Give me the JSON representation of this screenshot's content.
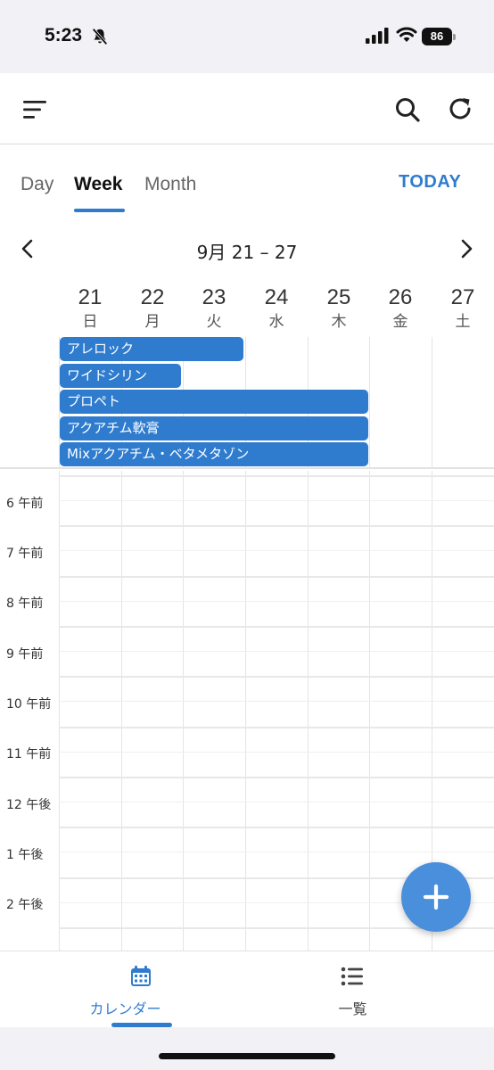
{
  "status_bar": {
    "time": "5:23",
    "battery": "86"
  },
  "app_bar": {
    "icons": [
      "menu-icon",
      "search-icon",
      "refresh-icon"
    ]
  },
  "view_tabs": {
    "tabs": [
      "Day",
      "Week",
      "Month"
    ],
    "active": "Week",
    "today_label": "TODAY"
  },
  "week_nav": {
    "range_label": "9月 21 – 27"
  },
  "days": [
    {
      "num": "21",
      "name": "日"
    },
    {
      "num": "22",
      "name": "月"
    },
    {
      "num": "23",
      "name": "火"
    },
    {
      "num": "24",
      "name": "水"
    },
    {
      "num": "25",
      "name": "木"
    },
    {
      "num": "26",
      "name": "金"
    },
    {
      "num": "27",
      "name": "土"
    }
  ],
  "all_day_events": [
    {
      "title": "アレロック",
      "start_day": "21",
      "end_day": "23"
    },
    {
      "title": "ワイドシリン",
      "start_day": "21",
      "end_day": "22"
    },
    {
      "title": "プロペト",
      "start_day": "21",
      "end_day": "25"
    },
    {
      "title": "アクアチム軟膏",
      "start_day": "21",
      "end_day": "25"
    },
    {
      "title": "Mixアクアチム・ベタメタゾン",
      "start_day": "21",
      "end_day": "25"
    }
  ],
  "time_labels": [
    "6 午前",
    "7 午前",
    "8 午前",
    "9 午前",
    "10 午前",
    "11 午前",
    "12 午後",
    "1 午後",
    "2 午後"
  ],
  "colors": {
    "accent": "#2f7ccf",
    "fab": "#4a8fdb"
  },
  "bottom_nav": {
    "items": [
      {
        "label": "カレンダー",
        "icon": "calendar-icon",
        "active": true
      },
      {
        "label": "一覧",
        "icon": "list-icon",
        "active": false
      }
    ]
  }
}
